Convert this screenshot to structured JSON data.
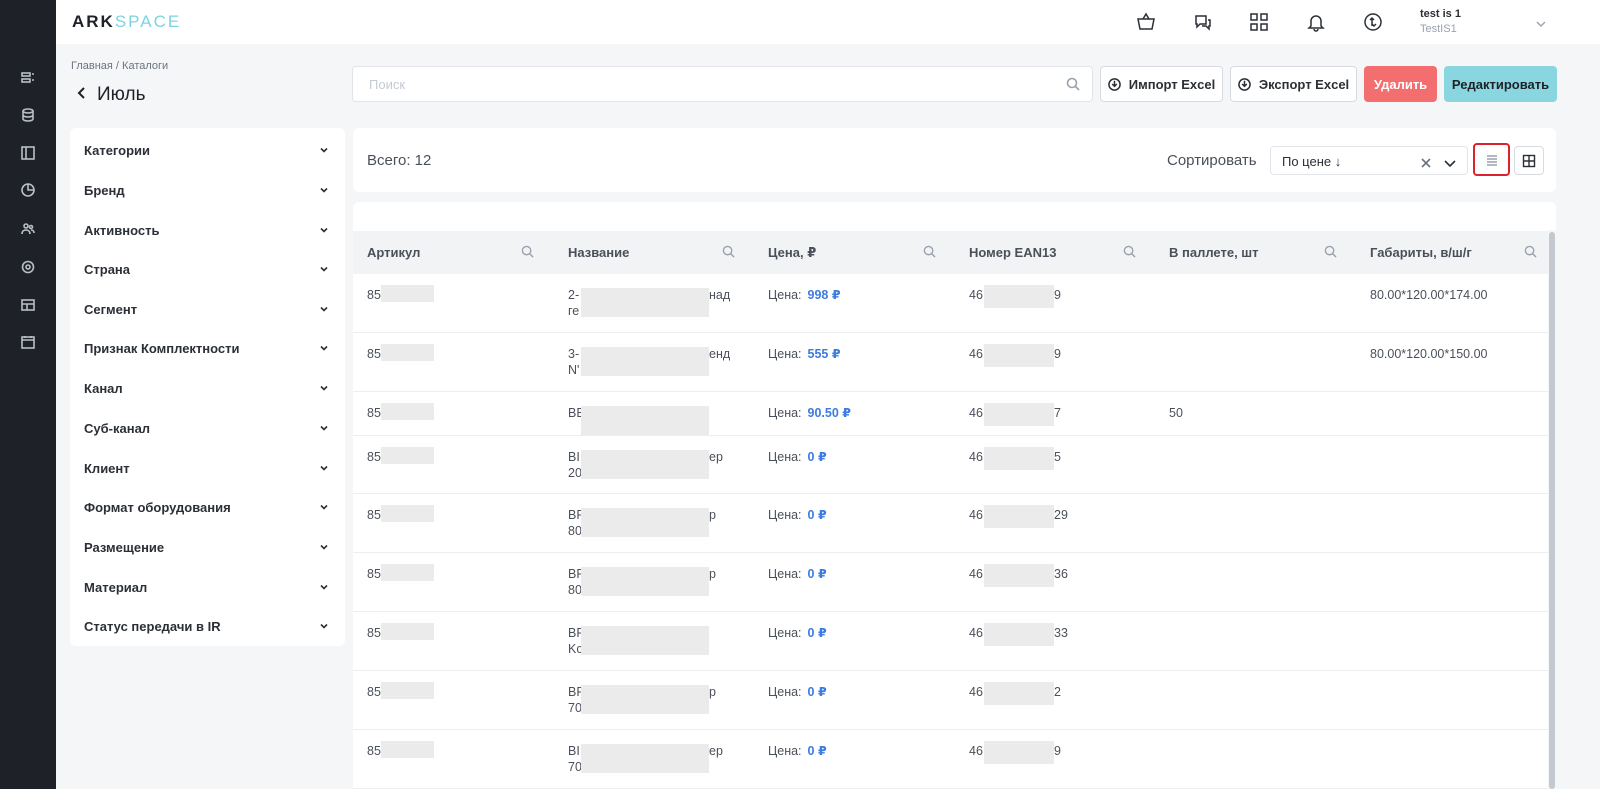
{
  "brand": {
    "part1": "ARK",
    "part2": "SPACE"
  },
  "header": {
    "user_name": "test is 1",
    "user_login": "TestIS1",
    "icons": [
      "basket-icon",
      "chat-question-icon",
      "apps-grid-icon",
      "bell-icon",
      "sync-icon"
    ]
  },
  "rail": {
    "icons": [
      "catalog-icon",
      "database-icon",
      "layout-icon",
      "chart-pie-icon",
      "users-icon",
      "settings-icon",
      "table-icon",
      "calendar-icon"
    ]
  },
  "breadcrumb": "Главная / Каталоги",
  "page_title": "Июль",
  "search": {
    "placeholder": "Поиск"
  },
  "actions": {
    "import": "Импорт Excel",
    "export": "Экспорт Excel",
    "delete": "Удалить",
    "edit": "Редактировать"
  },
  "filters": [
    "Категории",
    "Бренд",
    "Активность",
    "Страна",
    "Сегмент",
    "Признак Комплектности",
    "Канал",
    "Суб-канал",
    "Клиент",
    "Формат оборудования",
    "Размещение",
    "Материал",
    "Статус передачи в IR"
  ],
  "summary": {
    "total": "Всего: 12",
    "sort_label": "Сортировать",
    "sort_value": "По цене ↓"
  },
  "table": {
    "columns": [
      "Артикул",
      "Название",
      "Цена, ₽",
      "Номер EAN13",
      "В паллете, шт",
      "Габариты, в/ш/г"
    ],
    "rows": [
      {
        "sku": "85",
        "name1": "2-",
        "name1_tail": "над",
        "name2": "ге",
        "price_label": "Цена:",
        "price": "998 ₽",
        "ean_head": "46",
        "ean_tail": "9",
        "pallet": "",
        "dims": "80.00*120.00*174.00"
      },
      {
        "sku": "85",
        "name1": "3-",
        "name1_tail": "енд",
        "name2": "N'",
        "price_label": "Цена:",
        "price": "555 ₽",
        "ean_head": "46",
        "ean_tail": "9",
        "pallet": "",
        "dims": "80.00*120.00*150.00"
      },
      {
        "sku": "85",
        "name1": "BE",
        "name1_tail": "",
        "name2": "",
        "price_label": "Цена:",
        "price": "90.50 ₽",
        "ean_head": "46",
        "ean_tail": "7",
        "pallet": "50",
        "dims": ""
      },
      {
        "sku": "85",
        "name1": "BI",
        "name1_tail": "ер",
        "name2": "20",
        "price_label": "Цена:",
        "price": "0 ₽",
        "ean_head": "46",
        "ean_tail": "5",
        "pallet": "",
        "dims": ""
      },
      {
        "sku": "85",
        "name1": "BF",
        "name1_tail": "р",
        "name2": "80",
        "price_label": "Цена:",
        "price": "0 ₽",
        "ean_head": "46",
        "ean_tail": "29",
        "pallet": "",
        "dims": ""
      },
      {
        "sku": "85",
        "name1": "BF",
        "name1_tail": "р",
        "name2": "80",
        "price_label": "Цена:",
        "price": "0 ₽",
        "ean_head": "46",
        "ean_tail": "36",
        "pallet": "",
        "dims": ""
      },
      {
        "sku": "85",
        "name1": "BF",
        "name1_tail": "",
        "name2": "Kc",
        "price_label": "Цена:",
        "price": "0 ₽",
        "ean_head": "46",
        "ean_tail": "33",
        "pallet": "",
        "dims": ""
      },
      {
        "sku": "85",
        "name1": "BF",
        "name1_tail": "р",
        "name2": "70",
        "price_label": "Цена:",
        "price": "0 ₽",
        "ean_head": "46",
        "ean_tail": "2",
        "pallet": "",
        "dims": ""
      },
      {
        "sku": "85",
        "name1": "BI",
        "name1_tail": "ер",
        "name2": "70",
        "price_label": "Цена:",
        "price": "0 ₽",
        "ean_head": "46",
        "ean_tail": "9",
        "pallet": "",
        "dims": ""
      }
    ]
  },
  "colors": {
    "rail": "#1e2127",
    "accent_cyan": "#8ad6e0",
    "delete_red": "#f36f6f",
    "price_blue": "#3d7be0",
    "highlight": "#d9232d"
  }
}
